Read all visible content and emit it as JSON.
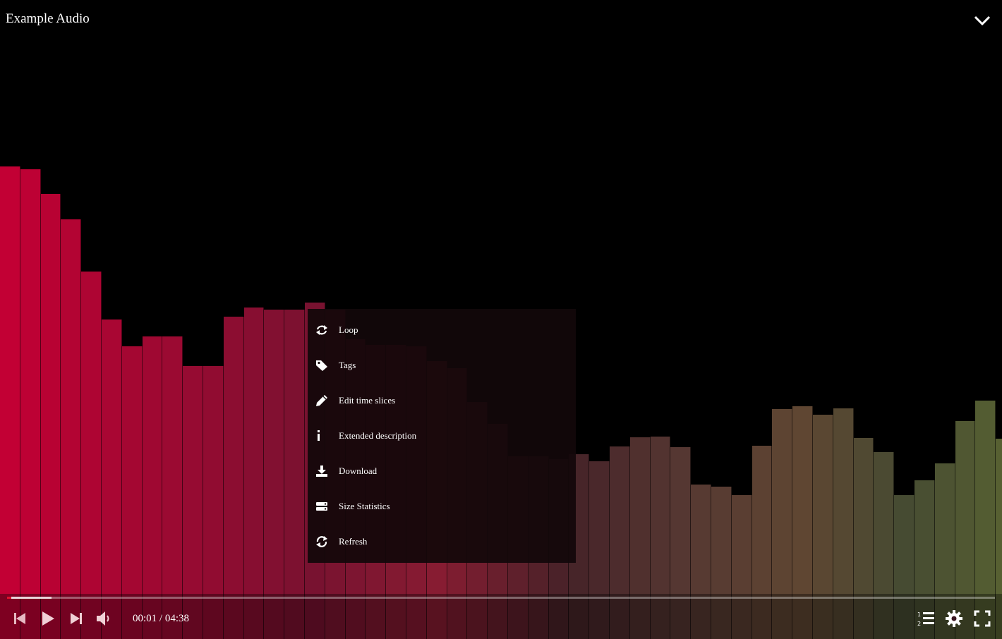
{
  "header": {
    "title": "Example Audio"
  },
  "menu": {
    "items": [
      {
        "label": "Loop",
        "icon": "loop-icon"
      },
      {
        "label": "Tags",
        "icon": "tag-icon"
      },
      {
        "label": "Edit time slices",
        "icon": "pencil-icon"
      },
      {
        "label": "Extended description",
        "icon": "info-icon"
      },
      {
        "label": "Download",
        "icon": "download-icon"
      },
      {
        "label": "Size Statistics",
        "icon": "size-statistics-icon"
      },
      {
        "label": "Refresh",
        "icon": "refresh-icon"
      }
    ]
  },
  "player": {
    "current_time": "00:01",
    "separator": "/",
    "duration": "04:38",
    "progress_played": 0.004,
    "progress_buffered": 0.045
  },
  "colors": {
    "accent": "#e0102e",
    "bar_start": "#c20034",
    "bar_end": "#4a6030"
  },
  "visualizer": {
    "levels": [
      0.74,
      0.735,
      0.696,
      0.657,
      0.575,
      0.5,
      0.458,
      0.473,
      0.473,
      0.427,
      0.427,
      0.504,
      0.519,
      0.515,
      0.515,
      0.527,
      0.515,
      0.469,
      0.46,
      0.46,
      0.458,
      0.435,
      0.424,
      0.371,
      0.337,
      0.286,
      0.286,
      0.281,
      0.289,
      0.278,
      0.301,
      0.316,
      0.317,
      0.3,
      0.242,
      0.238,
      0.225,
      0.302,
      0.36,
      0.364,
      0.351,
      0.361,
      0.315,
      0.293,
      0.225,
      0.248,
      0.275,
      0.341,
      0.373,
      0.313,
      0.203
    ]
  }
}
